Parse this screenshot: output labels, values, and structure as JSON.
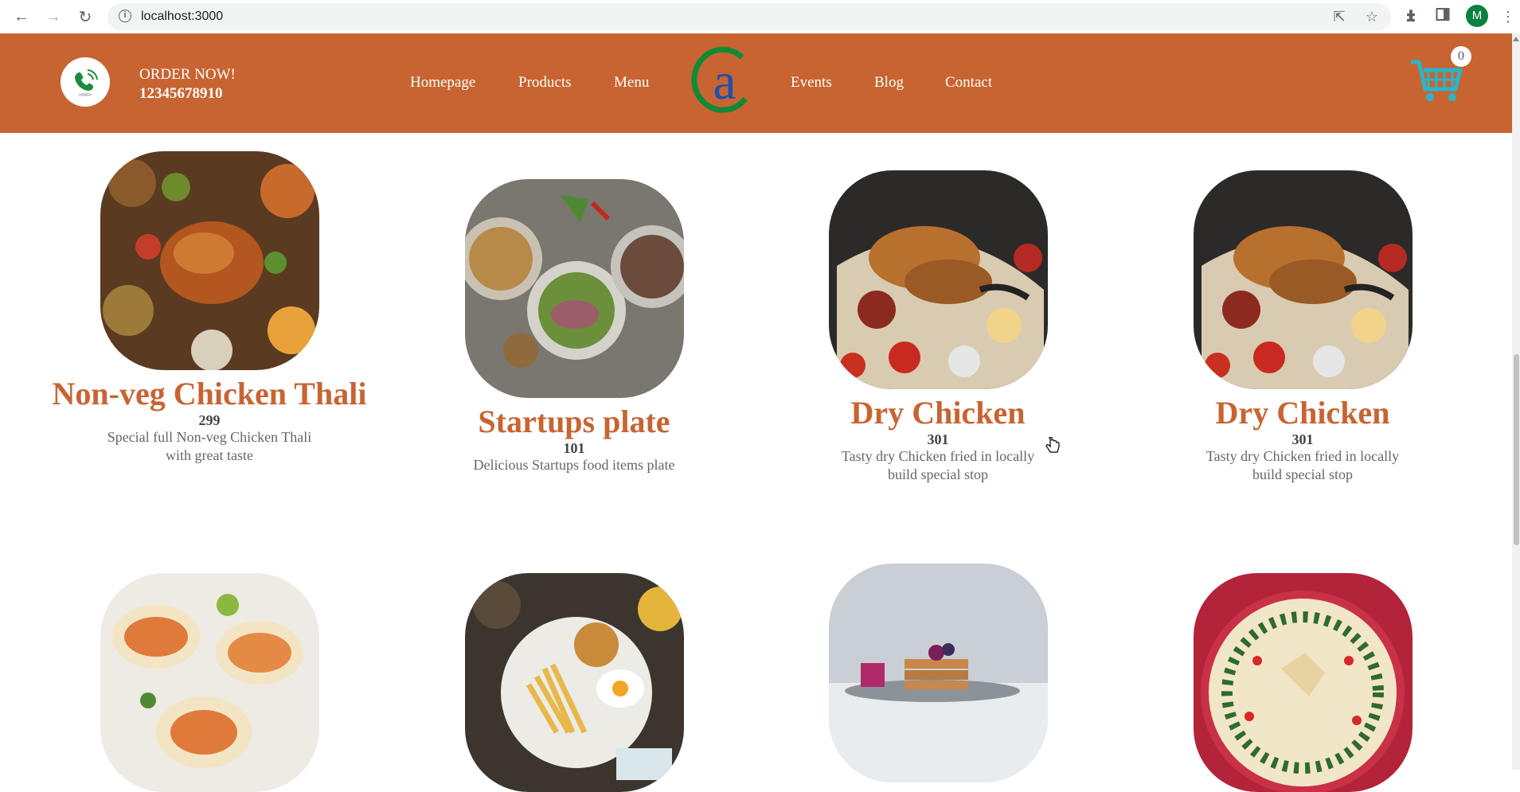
{
  "browser": {
    "url": "localhost:3000",
    "profile_initial": "M",
    "icons": [
      "back-icon",
      "forward-icon",
      "reload-icon",
      "info-icon",
      "share-icon",
      "star-icon",
      "extensions-icon",
      "sidepanel-icon",
      "menu-icon"
    ]
  },
  "header": {
    "order_label": "ORDER NOW!",
    "phone": "12345678910",
    "nav_left": [
      "Homepage",
      "Products",
      "Menu"
    ],
    "nav_right": [
      "Events",
      "Blog",
      "Contact"
    ],
    "logo_letter": "a",
    "cart_count": "0",
    "colors": {
      "brand": "#c86431",
      "cart": "#2bb5c8"
    }
  },
  "products": [
    {
      "name": "Non-veg Chicken Thali",
      "price": "299",
      "description": "Special full Non-veg Chicken Thali with great taste"
    },
    {
      "name": "Startups plate",
      "price": "101",
      "description": "Delicious Startups food items plate"
    },
    {
      "name": "Dry Chicken",
      "price": "301",
      "description": "Tasty dry Chicken fried in locally build special stop"
    },
    {
      "name": "Dry Chicken",
      "price": "301",
      "description": "Tasty dry Chicken fried in locally build special stop"
    }
  ],
  "lower_row_images": [
    "tacos-image",
    "fries-egg-plate-image",
    "pancakes-image",
    "pizza-wreath-image"
  ]
}
